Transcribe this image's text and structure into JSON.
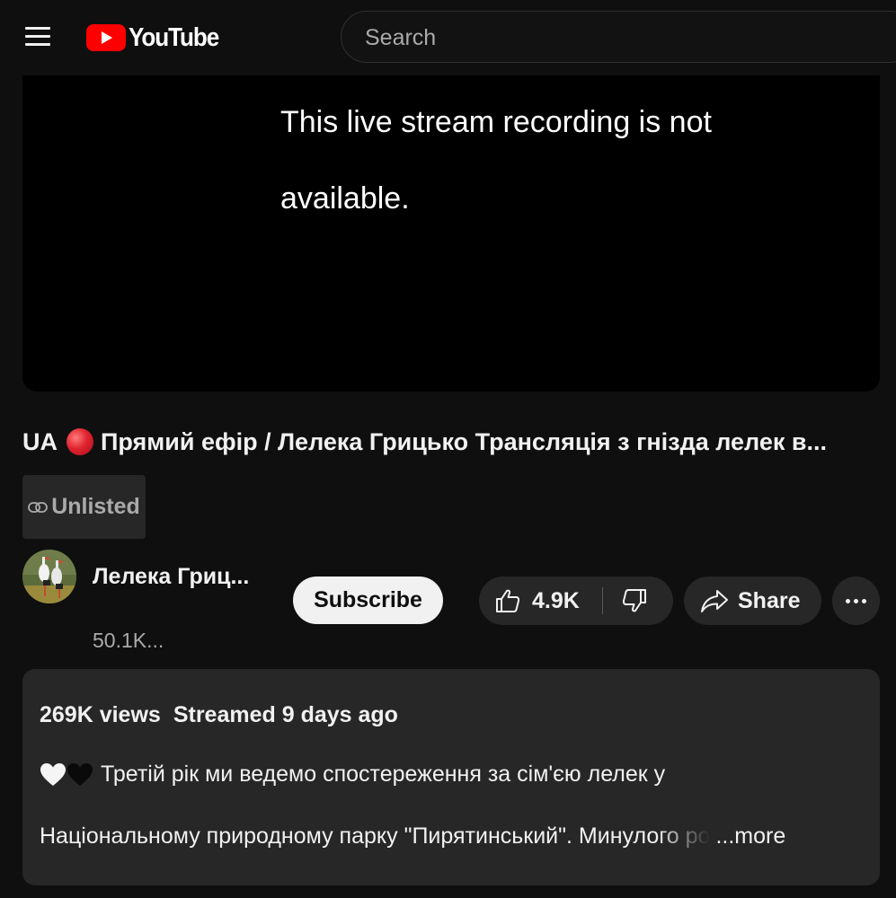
{
  "header": {
    "logo_text": "YouTube",
    "search_placeholder": "Search"
  },
  "player": {
    "message_line1": "This live stream recording is not",
    "message_line2": "available."
  },
  "video": {
    "title_prefix": "UA",
    "title": "Прямий ефір / Лелека Грицько Трансляція з гнізда лелек в...",
    "badge": "Unlisted"
  },
  "channel": {
    "name": "Лелека Гриц...",
    "subscribers": "50.1K..."
  },
  "actions": {
    "subscribe": "Subscribe",
    "like_count": "4.9K",
    "share": "Share"
  },
  "description": {
    "views": "269K views",
    "streamed": "Streamed 9 days ago",
    "line1": "Третій рік ми ведемо спостереження за сім'єю лелек у",
    "line2": "Національному природному парку \"Пирятинський\". Минулого ро",
    "more": "...more"
  },
  "colors": {
    "background": "#0f0f0f",
    "surface": "#272727",
    "brand_red": "#ff0000",
    "text_primary": "#f1f1f1",
    "text_secondary": "#aaaaaa"
  },
  "icons": [
    "menu-icon",
    "youtube-logo-icon",
    "link-icon",
    "live-dot-icon",
    "like-icon",
    "dislike-icon",
    "share-icon",
    "more-icon",
    "white-heart-icon",
    "black-heart-icon"
  ]
}
